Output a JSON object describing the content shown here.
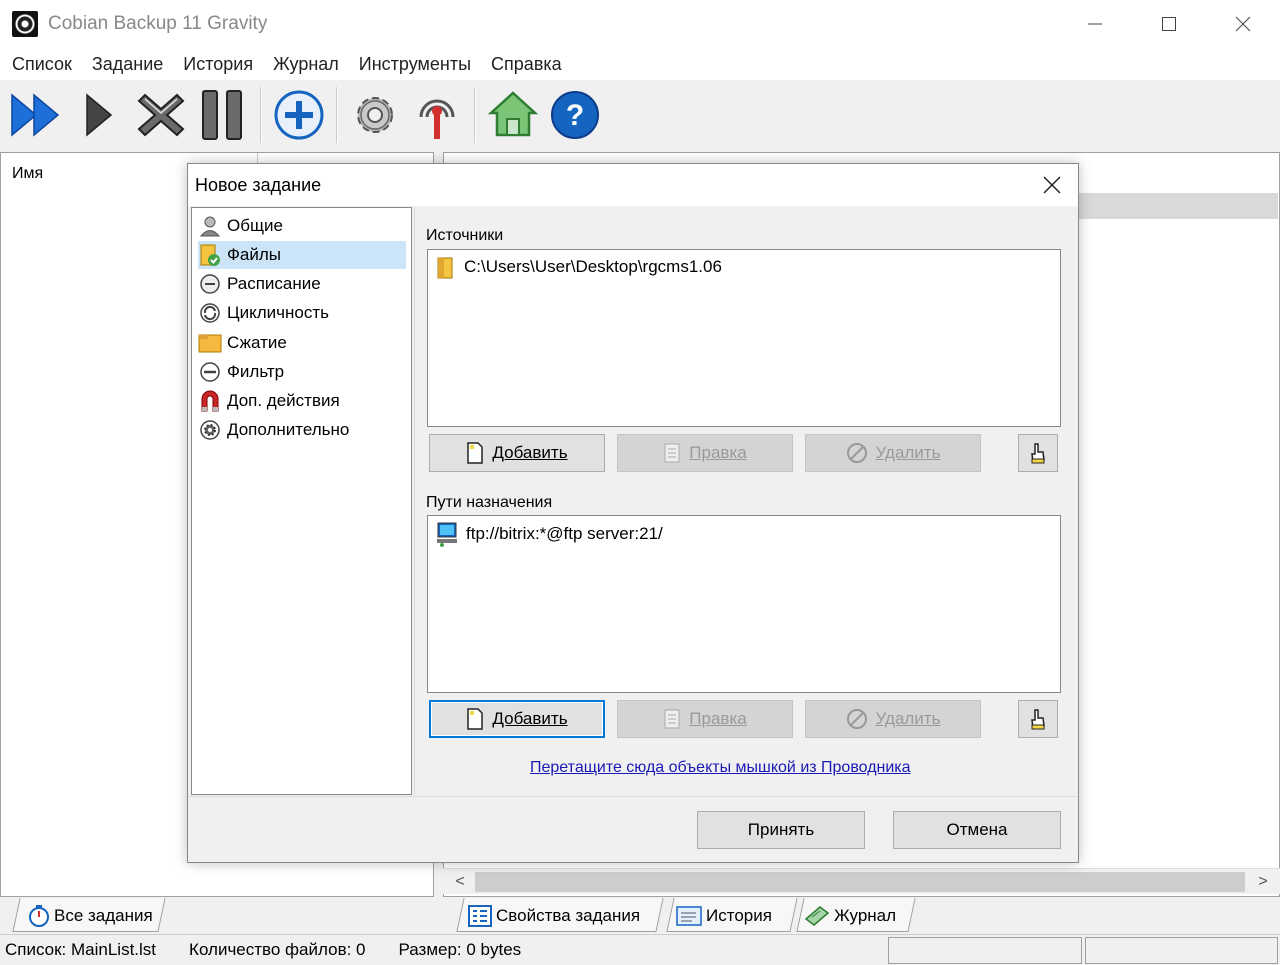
{
  "window": {
    "title": "Cobian Backup 11 Gravity",
    "controls": {
      "minimize": "—",
      "maximize": "☐",
      "close": "✕"
    }
  },
  "menu": [
    "Список",
    "Задание",
    "История",
    "Журнал",
    "Инструменты",
    "Справка"
  ],
  "toolbar": {
    "icons": [
      "run-all-icon",
      "run-icon",
      "stop-icon",
      "pause-icon",
      "add-task-icon",
      "settings-icon",
      "antenna-icon",
      "home-icon",
      "help-icon"
    ]
  },
  "list": {
    "column_name": "Имя"
  },
  "dialog": {
    "title": "Новое задание",
    "close": "✕",
    "nav": [
      {
        "label": "Общие",
        "icon": "user-icon"
      },
      {
        "label": "Файлы",
        "icon": "files-icon"
      },
      {
        "label": "Расписание",
        "icon": "clock-icon"
      },
      {
        "label": "Цикличность",
        "icon": "cycle-icon"
      },
      {
        "label": "Сжатие",
        "icon": "compression-icon"
      },
      {
        "label": "Фильтр",
        "icon": "filter-icon"
      },
      {
        "label": "Доп. действия",
        "icon": "magnet-icon"
      },
      {
        "label": "Дополнительно",
        "icon": "advanced-gear-icon"
      }
    ],
    "selected_nav": "Файлы",
    "sources_label": "Источники",
    "sources": [
      "C:\\Users\\User\\Desktop\\rgcms1.06"
    ],
    "destinations_label": "Пути назначения",
    "destinations": [
      "ftp://bitrix:*@ftp server:21/"
    ],
    "add_label": "Добавить",
    "edit_label": "Правка",
    "delete_label": "Удалить",
    "drop_hint": "Перетащите сюда объекты мышкой из Проводника",
    "accept_label": "Принять",
    "cancel_label": "Отмена"
  },
  "tabs": {
    "all_tasks": "Все задания",
    "task_properties": "Свойства задания",
    "history": "История",
    "log": "Журнал"
  },
  "status": {
    "list": "Список: MainList.lst",
    "file_count": "Количество файлов: 0",
    "size": "Размер: 0 bytes"
  },
  "colors": {
    "accent_blue": "#1565c0",
    "selection": "#cce4f7",
    "focus_border": "#0078d7",
    "link": "#1a1ab4"
  }
}
